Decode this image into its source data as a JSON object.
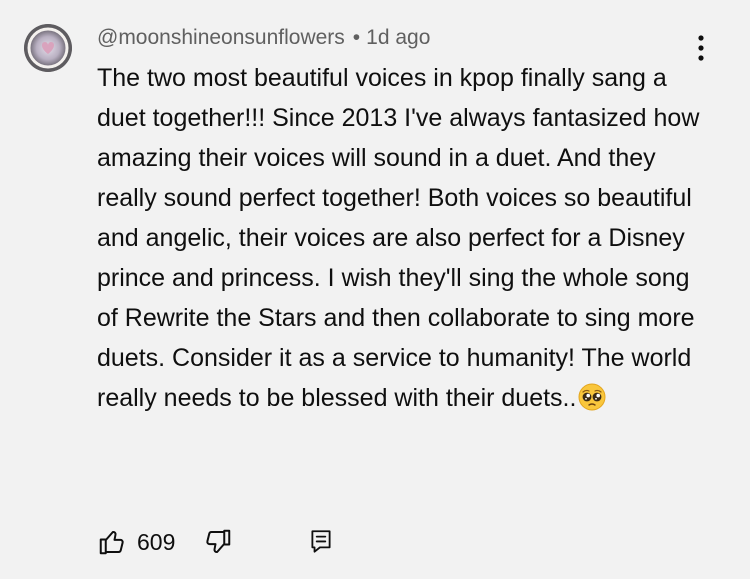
{
  "comment": {
    "author": "@moonshineonsunflowers",
    "separator": "•",
    "timestamp": "1d ago",
    "text": "The two most beautiful voices in kpop finally sang a duet together!!! Since 2013 I've always fantasized how amazing their voices will sound in a duet. And they really sound perfect together! Both voices so beautiful and angelic, their voices are also perfect for a Disney prince and princess. I wish they'll sing the whole song of Rewrite the Stars and then collaborate to sing more duets. Consider it as a service to humanity! The world really needs to be blessed with their duets..",
    "trailing_emoji": "pleading-face-emoji",
    "likes": "609"
  },
  "icons": {
    "avatar": "avatar-heart-icon",
    "more": "more-vertical-icon",
    "like": "thumbs-up-icon",
    "dislike": "thumbs-down-icon",
    "reply": "reply-comment-icon"
  },
  "colors": {
    "background": "#f2f2f2",
    "text": "#0f0f0f",
    "meta": "#606060"
  }
}
